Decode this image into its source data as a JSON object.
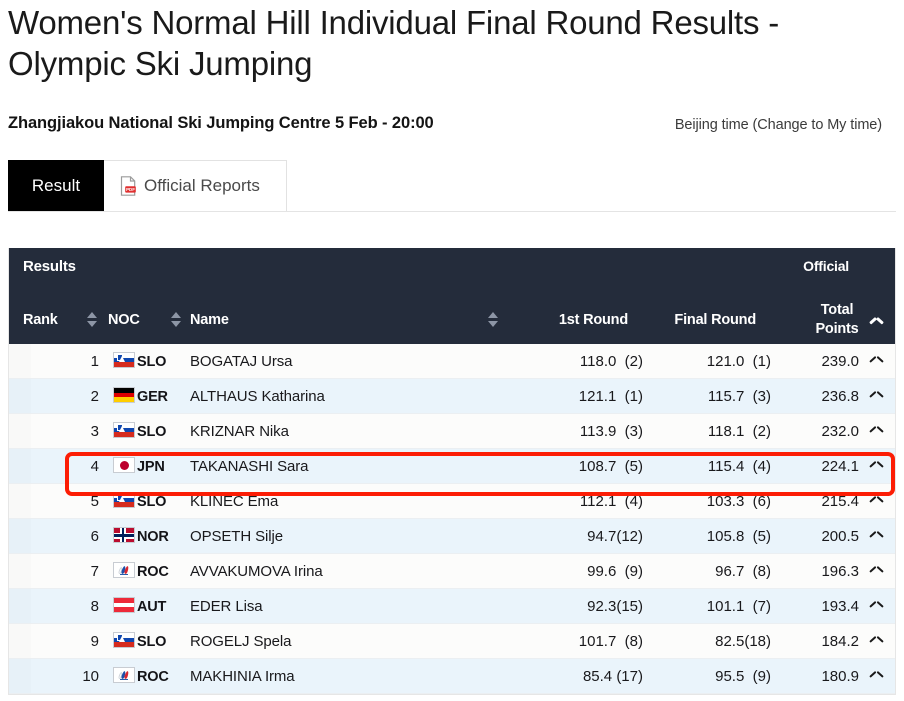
{
  "page": {
    "title": "Women's Normal Hill Individual Final Round Results - Olympic Ski Jumping",
    "venue_datetime": "Zhangjiakou National Ski Jumping Centre 5 Feb - 20:00",
    "timezone_note": "Beijing time (Change to My time)"
  },
  "tabs": [
    {
      "label": "Result",
      "active": true,
      "icon": ""
    },
    {
      "label": "Official Reports",
      "active": false,
      "icon": "pdf-icon"
    }
  ],
  "table": {
    "caption": "Results",
    "status_label": "Official",
    "columns": {
      "rank": "Rank",
      "noc": "NOC",
      "name": "Name",
      "first_round": "1st Round",
      "final_round": "Final Round",
      "total_points_line1": "Total",
      "total_points_line2": "Points"
    },
    "sort": {
      "active_column": "Total Points",
      "direction": "asc",
      "indicator": "chevron-up-icon"
    },
    "highlight": {
      "row_rank": 4,
      "color": "#fc1d05"
    },
    "rows": [
      {
        "rank": "1",
        "noc": "SLO",
        "name": "BOGATAJ Ursa",
        "first_round": "118.0  (2)",
        "final_round": "121.0  (1)",
        "total": "239.0"
      },
      {
        "rank": "2",
        "noc": "GER",
        "name": "ALTHAUS Katharina",
        "first_round": "121.1  (1)",
        "final_round": "115.7  (3)",
        "total": "236.8"
      },
      {
        "rank": "3",
        "noc": "SLO",
        "name": "KRIZNAR Nika",
        "first_round": "113.9  (3)",
        "final_round": "118.1  (2)",
        "total": "232.0"
      },
      {
        "rank": "4",
        "noc": "JPN",
        "name": "TAKANASHI Sara",
        "first_round": "108.7  (5)",
        "final_round": "115.4  (4)",
        "total": "224.1"
      },
      {
        "rank": "5",
        "noc": "SLO",
        "name": "KLINEC Ema",
        "first_round": "112.1  (4)",
        "final_round": "103.3  (6)",
        "total": "215.4"
      },
      {
        "rank": "6",
        "noc": "NOR",
        "name": "OPSETH Silje",
        "first_round": "94.7(12)",
        "final_round": "105.8  (5)",
        "total": "200.5"
      },
      {
        "rank": "7",
        "noc": "ROC",
        "name": "AVVAKUMOVA Irina",
        "first_round": "99.6  (9)",
        "final_round": "96.7  (8)",
        "total": "196.3"
      },
      {
        "rank": "8",
        "noc": "AUT",
        "name": "EDER Lisa",
        "first_round": "92.3(15)",
        "final_round": "101.1  (7)",
        "total": "193.4"
      },
      {
        "rank": "9",
        "noc": "SLO",
        "name": "ROGELJ Spela",
        "first_round": "101.7  (8)",
        "final_round": "82.5(18)",
        "total": "184.2"
      },
      {
        "rank": "10",
        "noc": "ROC",
        "name": "MAKHINIA Irma",
        "first_round": "85.4 (17)",
        "final_round": "95.5  (9)",
        "total": "180.9"
      }
    ]
  },
  "colors": {
    "header_bg": "#242c3b",
    "active_tab_bg": "#000000",
    "row_alt_bg": "#eaf4fb",
    "highlight": "#fc1d05"
  }
}
